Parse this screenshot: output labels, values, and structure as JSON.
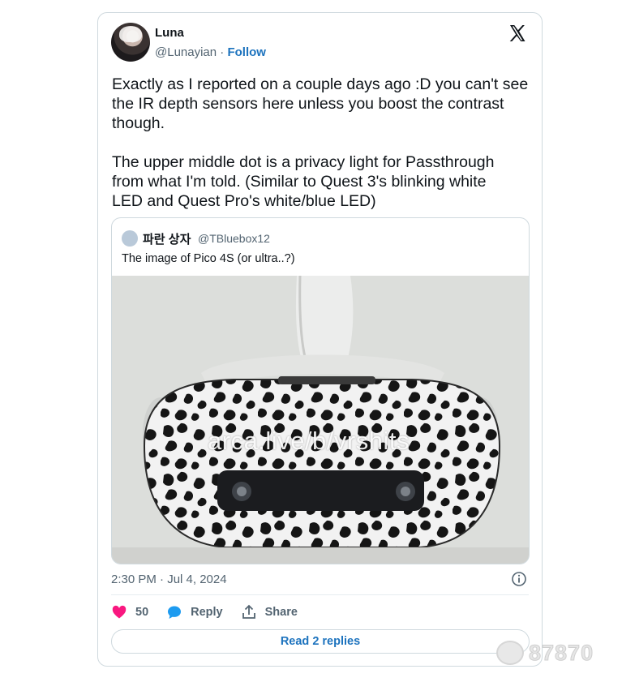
{
  "tweet": {
    "author_name": "Luna",
    "author_handle": "@Lunayian",
    "separator": "·",
    "follow_label": "Follow",
    "text": "Exactly as I reported on a couple days ago :D you can't see\nthe IR depth sensors here unless you boost the contrast\nthough.\n\nThe upper middle dot is a privacy light for Passthrough\nfrom what I'm told. (Similar to Quest 3's blinking white\nLED and Quest Pro's white/blue LED)",
    "timestamp": "2:30 PM · Jul 4, 2024",
    "likes_count": "50",
    "reply_label": "Reply",
    "share_label": "Share",
    "read_replies_label": "Read 2 replies",
    "icons": [
      "x-logo-icon",
      "info-icon",
      "heart-icon",
      "reply-bubble-icon",
      "share-icon"
    ],
    "colors": {
      "like": "#f91880",
      "link": "#1d73be",
      "reply": "#1d9bf0"
    }
  },
  "quote": {
    "author_name": "파란 상자",
    "author_handle": "@TBluebox12",
    "text": "The image of Pico 4S (or ultra..?)",
    "image_watermark": "arca.live/b/vrshits"
  },
  "site_watermark": "87870"
}
